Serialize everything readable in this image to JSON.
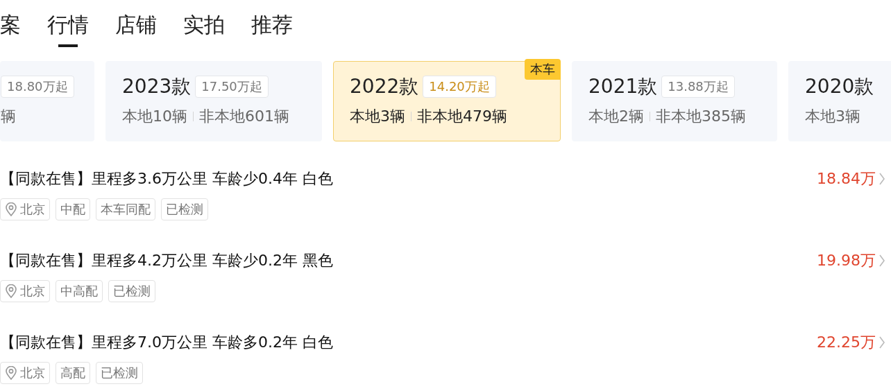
{
  "tabs": [
    {
      "label": "案",
      "selected": false
    },
    {
      "label": "行情",
      "selected": true
    },
    {
      "label": "店铺",
      "selected": false
    },
    {
      "label": "实拍",
      "selected": false
    },
    {
      "label": "推荐",
      "selected": false
    }
  ],
  "years": [
    {
      "kind": "cut-left",
      "price": "18.80万起",
      "nonlocal": "辆",
      "selected": false
    },
    {
      "kind": "full",
      "year": "2023款",
      "price": "17.50万起",
      "local": "本地10辆",
      "nonlocal": "非本地601辆",
      "selected": false
    },
    {
      "kind": "full",
      "year": "2022款",
      "price": "14.20万起",
      "local": "本地3辆",
      "nonlocal": "非本地479辆",
      "selected": true,
      "badge": "本车"
    },
    {
      "kind": "full",
      "year": "2021款",
      "price": "13.88万起",
      "local": "本地2辆",
      "nonlocal": "非本地385辆",
      "selected": false
    },
    {
      "kind": "cut-right",
      "year": "2020款",
      "local": "本地3辆",
      "selected": false
    }
  ],
  "listings": [
    {
      "title": "【同款在售】里程多3.6万公里 车龄少0.4年 白色",
      "price": "18.84万",
      "location": "北京",
      "tags": [
        "中配",
        "本车同配",
        "已检测"
      ]
    },
    {
      "title": "【同款在售】里程多4.2万公里 车龄少0.2年 黑色",
      "price": "19.98万",
      "location": "北京",
      "tags": [
        "中高配",
        "已检测"
      ]
    },
    {
      "title": "【同款在售】里程多7.0万公里 车龄多0.2年 白色",
      "price": "22.25万",
      "location": "北京",
      "tags": [
        "高配",
        "已检测"
      ]
    }
  ]
}
